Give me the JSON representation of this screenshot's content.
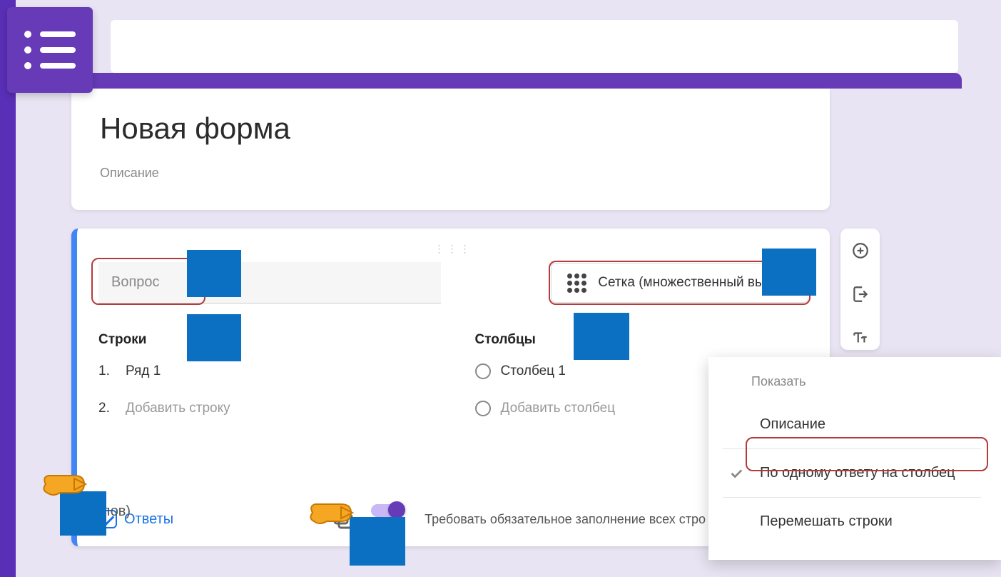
{
  "form": {
    "title": "Новая форма",
    "description": "Описание"
  },
  "question": {
    "placeholder": "Вопрос",
    "type_label": "Сетка (множественный выбор)",
    "rows_header": "Строки",
    "cols_header": "Столбцы",
    "row1_num": "1.",
    "row1": "Ряд 1",
    "row2_num": "2.",
    "add_row": "Добавить строку",
    "col1": "Столбец 1",
    "add_col": "Добавить столбец"
  },
  "footer": {
    "answers": "Ответы",
    "points_suffix": "аллов)",
    "require_label": "Требовать обязательное заполнение всех стро"
  },
  "popup": {
    "header": "Показать",
    "opt_description": "Описание",
    "opt_one_per_col": "По одному ответу на столбец",
    "opt_shuffle": "Перемешать строки"
  },
  "icons": {
    "add": "add-circle-icon",
    "import": "import-icon",
    "text": "text-icon",
    "copy": "copy-icon",
    "delete": "delete-icon"
  }
}
